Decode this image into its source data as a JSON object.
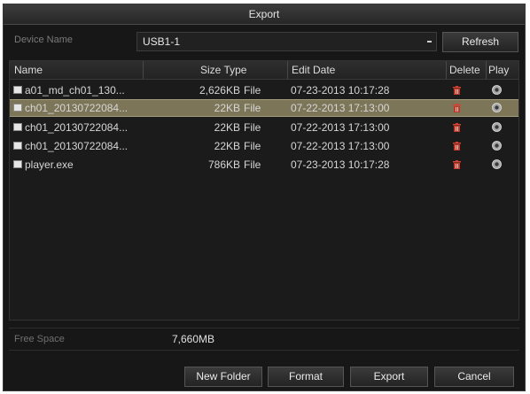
{
  "window": {
    "title": "Export"
  },
  "device": {
    "label": "Device Name",
    "selected": "USB1-1",
    "refresh_label": "Refresh"
  },
  "table": {
    "columns": {
      "name": "Name",
      "size_type": "Size Type",
      "edit_date": "Edit Date",
      "delete": "Delete",
      "play": "Play"
    },
    "rows": [
      {
        "name": "a01_md_ch01_130...",
        "size": "2,626KB",
        "type": "File",
        "date": "07-23-2013 10:17:28"
      },
      {
        "name": "ch01_20130722084...",
        "size": "22KB",
        "type": "File",
        "date": "07-22-2013 17:13:00"
      },
      {
        "name": "ch01_20130722084...",
        "size": "22KB",
        "type": "File",
        "date": "07-22-2013 17:13:00"
      },
      {
        "name": "ch01_20130722084...",
        "size": "22KB",
        "type": "File",
        "date": "07-22-2013 17:13:00"
      },
      {
        "name": "player.exe",
        "size": "786KB",
        "type": "File",
        "date": "07-23-2013 10:17:28"
      }
    ],
    "selected_row": 1
  },
  "free_space": {
    "label": "Free Space",
    "value": "7,660MB"
  },
  "buttons": {
    "new_folder": "New Folder",
    "format": "Format",
    "export": "Export",
    "cancel": "Cancel"
  },
  "colors": {
    "background": "#171717",
    "selected_row": "#7c7558",
    "trash_icon": "#c0392b"
  },
  "icons": {
    "row_file": "file-icon",
    "row_delete": "trash-icon",
    "row_play": "play-icon"
  }
}
